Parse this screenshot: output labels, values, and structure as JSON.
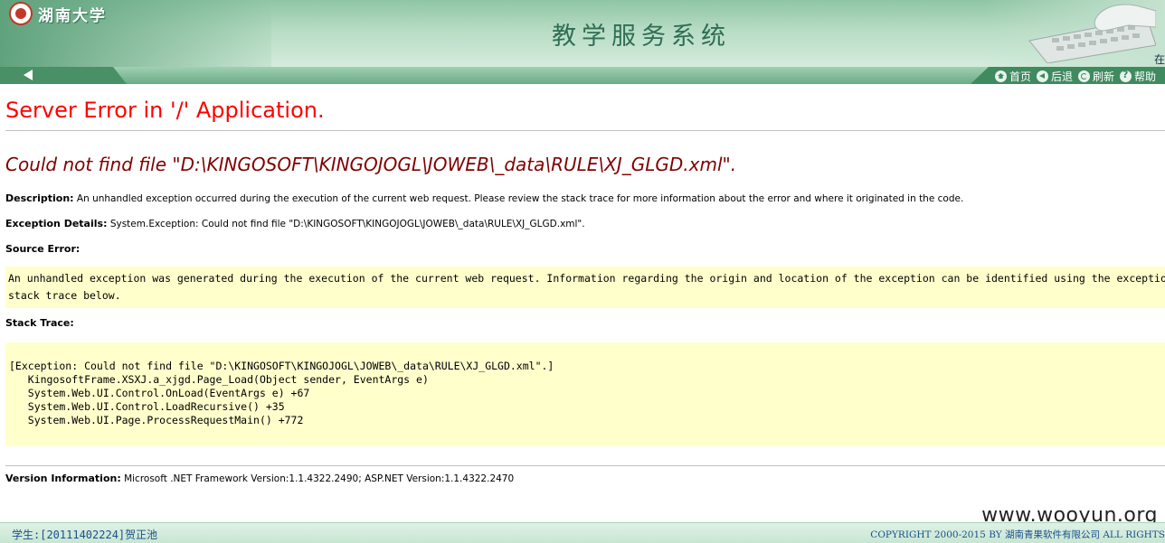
{
  "header": {
    "university": "湖南大学",
    "system_title": "教学服务系统",
    "login_hint": "在"
  },
  "nav": {
    "links": [
      {
        "label": "首页",
        "icon": "home-icon"
      },
      {
        "label": "后退",
        "icon": "back-icon"
      },
      {
        "label": "刷新",
        "icon": "refresh-icon"
      },
      {
        "label": "帮助",
        "icon": "help-icon"
      }
    ]
  },
  "error": {
    "title": "Server Error in '/' Application.",
    "message": "Could not find file \"D:\\KINGOSOFT\\KINGOJOGL\\JOWEB\\_data\\RULE\\XJ_GLGD.xml\".",
    "description_label": "Description:",
    "description": "An unhandled exception occurred during the execution of the current web request. Please review the stack trace for more information about the error and where it originated in the code.",
    "exception_label": "Exception Details:",
    "exception": "System.Exception: Could not find file \"D:\\KINGOSOFT\\KINGOJOGL\\JOWEB\\_data\\RULE\\XJ_GLGD.xml\".",
    "source_label": "Source Error:",
    "source_text": "An unhandled exception was generated during the execution of the current web request. Information regarding the origin and location of the exception can be identified using the exception\nstack trace below.",
    "stack_label": "Stack Trace:",
    "stack_text": "\n[Exception: Could not find file \"D:\\KINGOSOFT\\KINGOJOGL\\JOWEB\\_data\\RULE\\XJ_GLGD.xml\".]\n   KingosoftFrame.XSXJ.a_xjgd.Page_Load(Object sender, EventArgs e)\n   System.Web.UI.Control.OnLoad(EventArgs e) +67\n   System.Web.UI.Control.LoadRecursive() +35\n   System.Web.UI.Page.ProcessRequestMain() +772\n",
    "version_label": "Version Information:",
    "version": "Microsoft .NET Framework Version:1.1.4322.2490; ASP.NET Version:1.1.4322.2470"
  },
  "watermark": "www.wooyun.org",
  "footer": {
    "student": "学生:[20111402224]贺正池",
    "copyright": "COPYRIGHT 2000-2015 BY 湖南青果软件有限公司 ALL RIGHTS"
  },
  "colors": {
    "header_green": "#8fc5a4",
    "error_red": "#ff0000",
    "message_maroon": "#800000",
    "code_background": "#ffffcc"
  }
}
